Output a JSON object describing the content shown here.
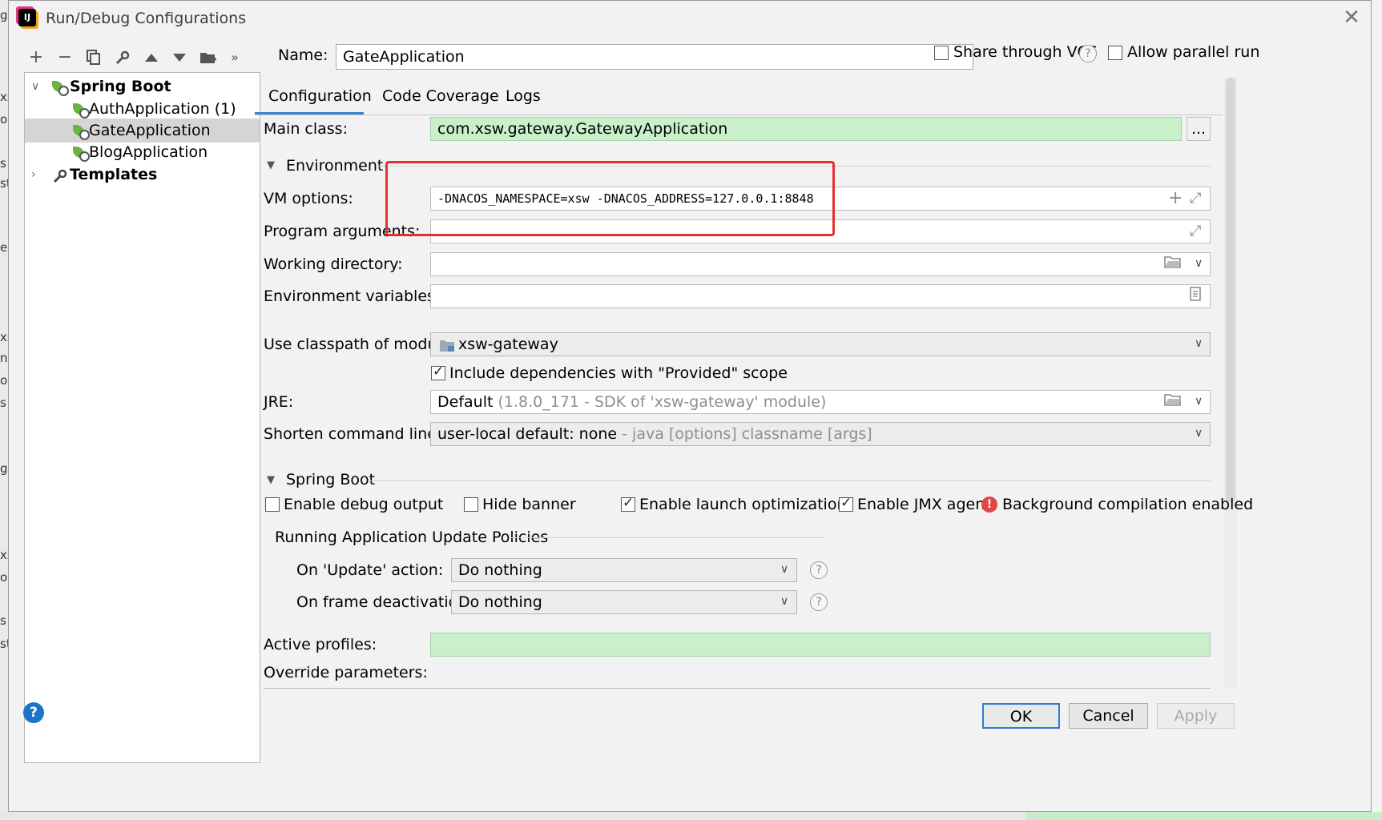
{
  "background": {
    "left_fragments": [
      "g",
      "xs",
      "oc",
      "s",
      "st",
      "e",
      "xs",
      "ni",
      "oc",
      "s",
      "g",
      "xs",
      "oc",
      "s",
      "st"
    ]
  },
  "window": {
    "title": "Run/Debug Configurations",
    "logo": "IJ"
  },
  "toolbar": {
    "icons": [
      "plus-icon",
      "minus-icon",
      "copy-icon",
      "wrench-icon",
      "arrow-up-icon",
      "arrow-down-icon",
      "folder-add-icon",
      "more-icon"
    ]
  },
  "tree": {
    "root_label": "Spring Boot",
    "items": [
      {
        "label": "AuthApplication (1)"
      },
      {
        "label": "GateApplication"
      },
      {
        "label": "BlogApplication"
      }
    ],
    "templates_label": "Templates"
  },
  "name_label": "Name:",
  "name_value": "GateApplication",
  "share_vcs_label": "Share through VCS",
  "allow_parallel_label": "Allow parallel run",
  "tabs": [
    "Configuration",
    "Code Coverage",
    "Logs"
  ],
  "form": {
    "main_class_label": "Main class:",
    "main_class_value": "com.xsw.gateway.GatewayApplication",
    "browse_label": "...",
    "environment_label": "Environment",
    "vm_options_label": "VM options:",
    "vm_options_value": "-DNACOS_NAMESPACE=xsw -DNACOS_ADDRESS=127.0.0.1:8848",
    "program_args_label": "Program arguments:",
    "working_dir_label": "Working directory:",
    "env_vars_label": "Environment variables:",
    "classpath_label": "Use classpath of module:",
    "classpath_value": "xsw-gateway",
    "include_deps_label": "Include dependencies with \"Provided\" scope",
    "jre_label": "JRE:",
    "jre_value": "Default",
    "jre_hint": "(1.8.0_171 - SDK of 'xsw-gateway' module)",
    "shorten_label": "Shorten command line:",
    "shorten_value": "user-local default: none",
    "shorten_hint": "- java [options] classname [args]",
    "spring_boot_section": "Spring Boot",
    "debug_output_label": "Enable debug output",
    "hide_banner_label": "Hide banner",
    "launch_opt_label": "Enable launch optimization",
    "jmx_label": "Enable JMX agent",
    "bg_compile_label": "Background compilation enabled",
    "update_policies_label": "Running Application Update Policies",
    "on_update_label": "On 'Update' action:",
    "on_update_value": "Do nothing",
    "on_frame_label": "On frame deactivation:",
    "on_frame_value": "Do nothing",
    "active_profiles_label": "Active profiles:",
    "override_params_label": "Override parameters:"
  },
  "buttons": {
    "ok": "OK",
    "cancel": "Cancel",
    "apply": "Apply",
    "help": "?"
  },
  "colors": {
    "accent": "#4083c9",
    "highlight": "#e53032",
    "green_field": "#c9efcb"
  }
}
